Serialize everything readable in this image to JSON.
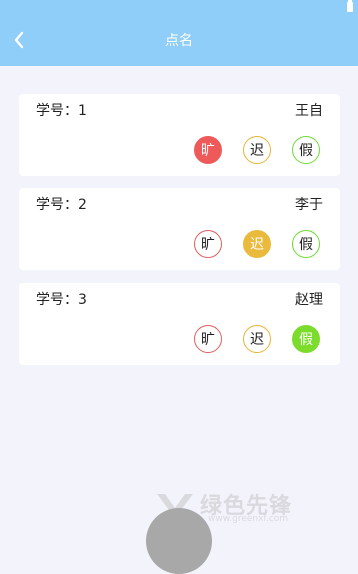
{
  "header": {
    "title": "点名"
  },
  "students": [
    {
      "id_label": "学号：1",
      "name": "王自",
      "active": "absent"
    },
    {
      "id_label": "学号：2",
      "name": "李于",
      "active": "late"
    },
    {
      "id_label": "学号：3",
      "name": "赵理",
      "active": "leave"
    }
  ],
  "status_labels": {
    "absent": "旷",
    "late": "迟",
    "leave": "假"
  },
  "colors": {
    "header_bg": "#8fcef8",
    "absent": "#ee5a5a",
    "late": "#eaba3c",
    "leave": "#7bdc2c"
  },
  "watermark": {
    "text": "绿色先锋",
    "sub": "www.greenxf.com"
  }
}
